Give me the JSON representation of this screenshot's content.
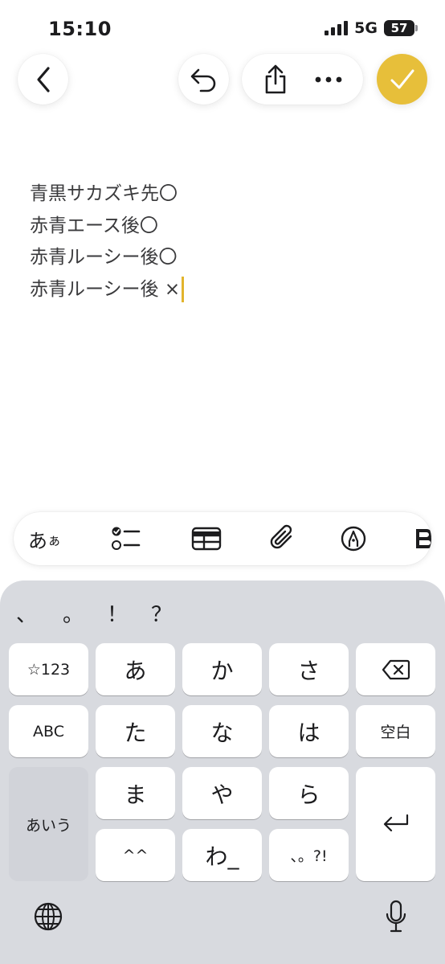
{
  "status": {
    "time": "15:10",
    "network": "5G",
    "battery": "57"
  },
  "toolbar": {
    "back_icon": "chevron-left-icon",
    "undo_icon": "undo-icon",
    "share_icon": "share-icon",
    "more_icon": "ellipsis-icon",
    "done_icon": "checkmark-icon",
    "accent_color": "#e7bf3a"
  },
  "note": {
    "lines": [
      "青黒サカズキ先〇",
      "赤青エース後〇",
      "赤青ルーシー後〇",
      "赤青ルーシー後 ×"
    ],
    "caret_color": "#e2b42c"
  },
  "format_bar": {
    "text_style_label": "あ",
    "text_style_small": "ぁ",
    "checklist_icon": "checklist-icon",
    "table_icon": "table-icon",
    "attachment_icon": "paperclip-icon",
    "markup_icon": "markup-pen-icon"
  },
  "keyboard": {
    "punctuation": [
      "、",
      "。",
      "！",
      "？"
    ],
    "row1": [
      "☆123",
      "あ",
      "か",
      "さ"
    ],
    "row2": [
      "ABC",
      "た",
      "な",
      "は",
      "空白"
    ],
    "row3": [
      "ま",
      "や",
      "ら"
    ],
    "row4": [
      "^^",
      "わ_",
      "、。?!"
    ],
    "mode_key": "あいう",
    "backspace_icon": "delete-backward-icon",
    "return_icon": "return-icon",
    "globe_icon": "globe-icon",
    "mic_icon": "microphone-icon",
    "background": "#d8dadf"
  }
}
